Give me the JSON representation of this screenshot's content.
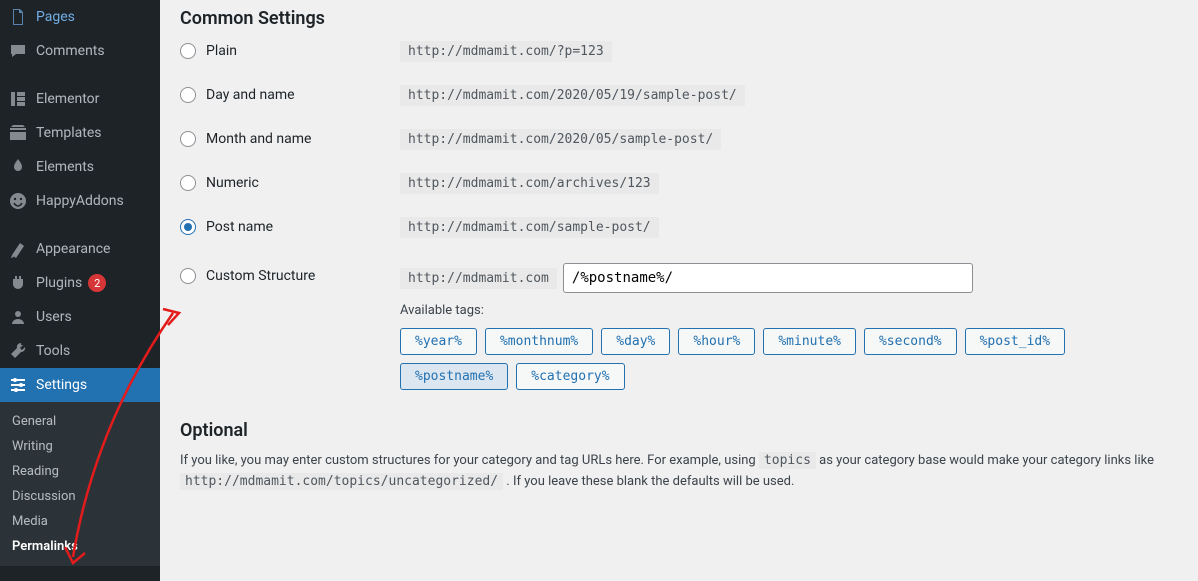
{
  "sidebar": {
    "items": [
      {
        "label": "Pages",
        "icon": "pages"
      },
      {
        "label": "Comments",
        "icon": "comments"
      },
      {
        "label": "Elementor",
        "icon": "elementor"
      },
      {
        "label": "Templates",
        "icon": "templates"
      },
      {
        "label": "Elements",
        "icon": "elements"
      },
      {
        "label": "HappyAddons",
        "icon": "happy"
      },
      {
        "label": "Appearance",
        "icon": "appearance"
      },
      {
        "label": "Plugins",
        "icon": "plugins",
        "badge": "2"
      },
      {
        "label": "Users",
        "icon": "users"
      },
      {
        "label": "Tools",
        "icon": "tools"
      },
      {
        "label": "Settings",
        "icon": "settings",
        "active": true
      }
    ],
    "submenu": [
      {
        "label": "General"
      },
      {
        "label": "Writing"
      },
      {
        "label": "Reading"
      },
      {
        "label": "Discussion"
      },
      {
        "label": "Media"
      },
      {
        "label": "Permalinks",
        "current": true
      }
    ]
  },
  "headings": {
    "common": "Common Settings",
    "optional": "Optional"
  },
  "options": {
    "plain": {
      "label": "Plain",
      "example": "http://mdmamit.com/?p=123"
    },
    "day": {
      "label": "Day and name",
      "example": "http://mdmamit.com/2020/05/19/sample-post/"
    },
    "month": {
      "label": "Month and name",
      "example": "http://mdmamit.com/2020/05/sample-post/"
    },
    "numeric": {
      "label": "Numeric",
      "example": "http://mdmamit.com/archives/123"
    },
    "postname": {
      "label": "Post name",
      "example": "http://mdmamit.com/sample-post/"
    },
    "custom": {
      "label": "Custom Structure",
      "prefix": "http://mdmamit.com",
      "value": "/%postname%/"
    }
  },
  "tags": {
    "available_label": "Available tags:",
    "list": [
      "%year%",
      "%monthnum%",
      "%day%",
      "%hour%",
      "%minute%",
      "%second%",
      "%post_id%",
      "%postname%",
      "%category%"
    ]
  },
  "optional_text": {
    "part1": "If you like, you may enter custom structures for your category and tag URLs here. For example, using ",
    "code1": "topics",
    "part2": " as your category base would make your category links like ",
    "code2": "http://mdmamit.com/topics/uncategorized/",
    "part3": " . If you leave these blank the defaults will be used."
  }
}
